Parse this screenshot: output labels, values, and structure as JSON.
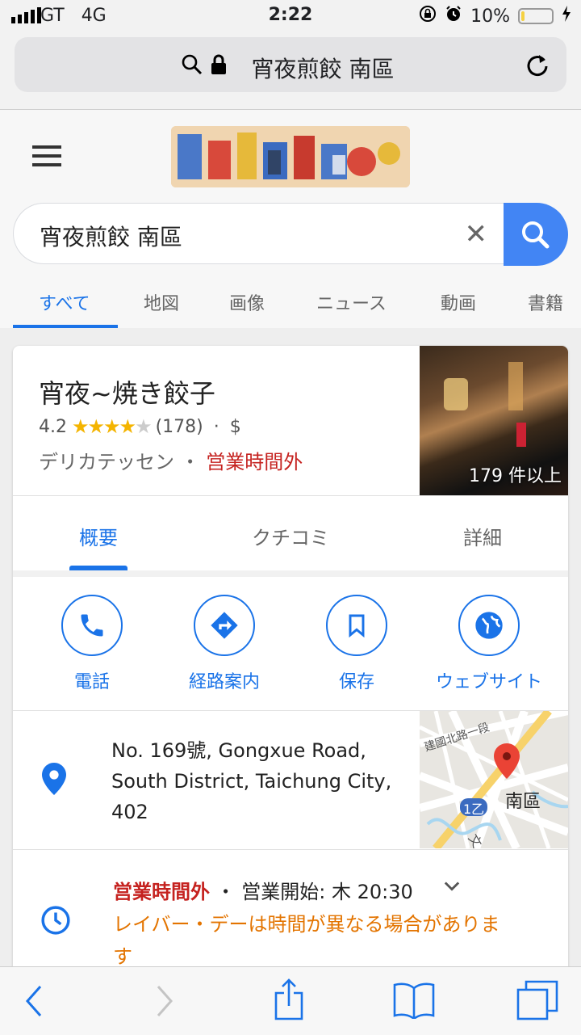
{
  "status_bar": {
    "carrier": "GT",
    "network": "4G",
    "time": "2:22",
    "battery": "10%",
    "battery_level": 0.1
  },
  "url_bar": {
    "text": "宵夜煎餃 南區"
  },
  "search": {
    "query": "宵夜煎餃 南區"
  },
  "tabs": [
    {
      "label": "すべて"
    },
    {
      "label": "地図"
    },
    {
      "label": "画像"
    },
    {
      "label": "ニュース"
    },
    {
      "label": "動画"
    },
    {
      "label": "書籍"
    }
  ],
  "place": {
    "name": "宵夜~焼き餃子",
    "rating": "4.2",
    "rating_stars": 4,
    "reviews": "(178)",
    "price": "$",
    "category": "デリカテッセン",
    "status": "営業時間外",
    "photo_count": "179 件以上"
  },
  "card_tabs": [
    {
      "label": "概要"
    },
    {
      "label": "クチコミ"
    },
    {
      "label": "詳細"
    }
  ],
  "actions": [
    {
      "label": "電話",
      "icon": "phone-icon"
    },
    {
      "label": "経路案内",
      "icon": "directions-icon"
    },
    {
      "label": "保存",
      "icon": "bookmark-icon"
    },
    {
      "label": "ウェブサイト",
      "icon": "globe-icon"
    }
  ],
  "address": {
    "line1": "No. 169號, Gongxue Road,",
    "line2": "South District, Taichung City,",
    "line3": "402"
  },
  "map": {
    "road_label": "建國北路一段",
    "route_badge": "1乙",
    "district": "南區",
    "partial_label": "文"
  },
  "hours": {
    "status": "営業時間外",
    "opens": "営業開始: 木 20:30",
    "note": "レイバー・デーは時間が異なる場合がありま",
    "note_cont": "す"
  },
  "colors": {
    "accent": "#1a73e8",
    "search_button": "#4285f4",
    "closed": "#c5221f",
    "warning": "#e37400",
    "star": "#f4b400"
  }
}
